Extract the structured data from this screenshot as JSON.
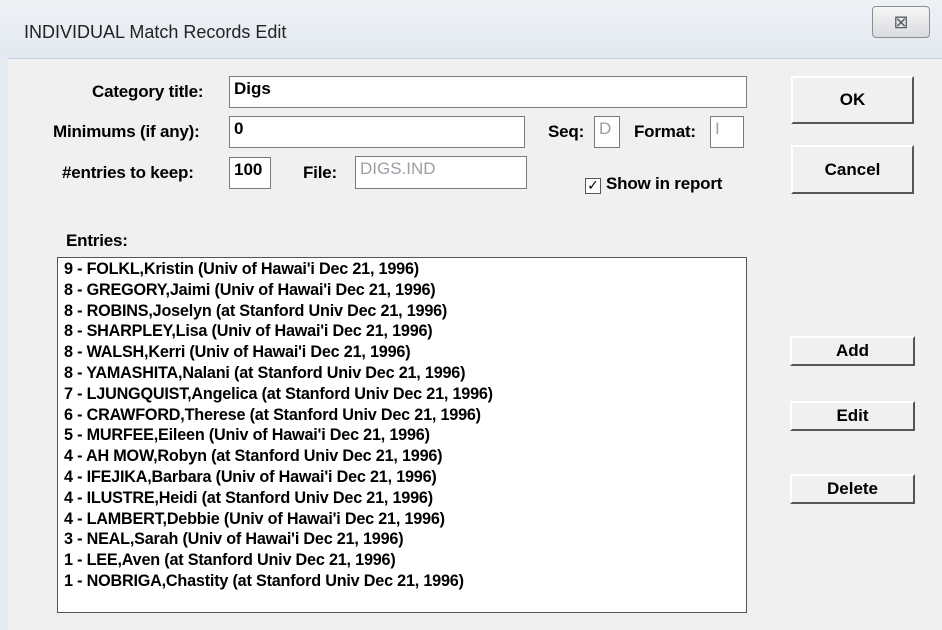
{
  "window": {
    "title": "INDIVIDUAL Match Records Edit",
    "close_symbol": "⊠"
  },
  "form": {
    "category_title_label": "Category title:",
    "category_title_value": "Digs",
    "minimums_label": "Minimums (if any):",
    "minimums_value": "0",
    "seq_label": "Seq:",
    "seq_value": "D",
    "format_label": "Format:",
    "format_value": "I",
    "entries_keep_label": "#entries to keep:",
    "entries_keep_value": "100",
    "file_label": "File:",
    "file_value": "DIGS.IND",
    "show_in_report_label": "Show in report",
    "show_in_report_checked": true,
    "check_mark": "✓"
  },
  "buttons": {
    "ok": "OK",
    "cancel": "Cancel",
    "add": "Add",
    "edit": "Edit",
    "delete": "Delete"
  },
  "entries": {
    "label": "Entries:",
    "items": [
      "9 - FOLKL,Kristin (Univ of Hawai'i Dec 21, 1996)",
      "8 - GREGORY,Jaimi (Univ of Hawai'i Dec 21, 1996)",
      "8 - ROBINS,Joselyn (at Stanford Univ Dec 21, 1996)",
      "8 - SHARPLEY,Lisa (Univ of Hawai'i Dec 21, 1996)",
      "8 - WALSH,Kerri (Univ of Hawai'i Dec 21, 1996)",
      "8 - YAMASHITA,Nalani (at Stanford Univ Dec 21, 1996)",
      "7 - LJUNGQUIST,Angelica (at Stanford Univ Dec 21, 1996)",
      "6 - CRAWFORD,Therese (at Stanford Univ Dec 21, 1996)",
      "5 - MURFEE,Eileen (Univ of Hawai'i Dec 21, 1996)",
      "4 - AH MOW,Robyn (at Stanford Univ Dec 21, 1996)",
      "4 - IFEJIKA,Barbara (Univ of Hawai'i Dec 21, 1996)",
      "4 - ILUSTRE,Heidi (at Stanford Univ Dec 21, 1996)",
      "4 - LAMBERT,Debbie (Univ of Hawai'i Dec 21, 1996)",
      "3 - NEAL,Sarah (Univ of Hawai'i Dec 21, 1996)",
      "1 - LEE,Aven (at Stanford Univ Dec 21, 1996)",
      "1 - NOBRIGA,Chastity (at Stanford Univ Dec 21, 1996)"
    ]
  }
}
